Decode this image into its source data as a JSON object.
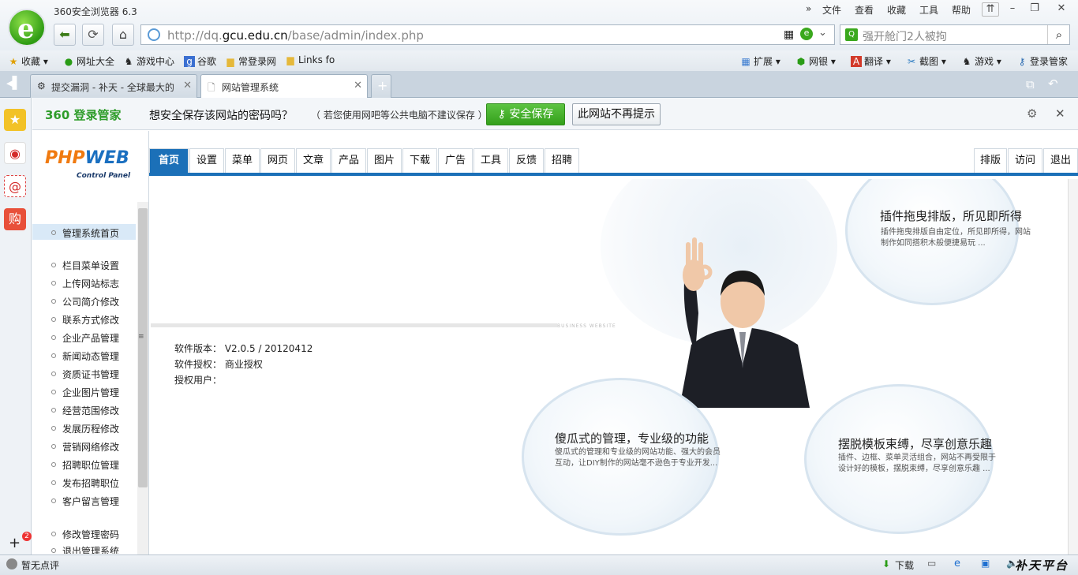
{
  "browser": {
    "title": "360安全浏览器 6.3",
    "menus": [
      "文件",
      "查看",
      "收藏",
      "工具",
      "帮助"
    ],
    "url_prefix": "http://dq.",
    "url_domain": "gcu.edu.cn",
    "url_path": "/base/admin/index.php",
    "search_placeholder": "强开舱门2人被拘"
  },
  "favorites": {
    "left": [
      "收藏",
      "网址大全",
      "游戏中心",
      "谷歌",
      "常登录网",
      "Links fo"
    ],
    "right": [
      "扩展",
      "网银",
      "翻译",
      "截图",
      "游戏",
      "登录管家"
    ]
  },
  "tabs": [
    {
      "label": "提交漏洞 - 补天 - 全球最大的"
    },
    {
      "label": "网站管理系统"
    }
  ],
  "password_bar": {
    "brand": "360 登录管家",
    "question": "想安全保存该网站的密码吗？",
    "note": "（ 若您使用网吧等公共电脑不建议保存 ）",
    "save": "安全保存",
    "never": "此网站不再提示"
  },
  "cms": {
    "logo_main": "PHP",
    "logo_accent": "WEB",
    "logo_sub": "Control Panel",
    "nav": [
      "首页",
      "设置",
      "菜单",
      "网页",
      "文章",
      "产品",
      "图片",
      "下载",
      "广告",
      "工具",
      "反馈",
      "招聘"
    ],
    "nav_right": [
      "排版",
      "访问",
      "退出"
    ],
    "menu_home": "管理系统首页",
    "menu": [
      "栏目菜单设置",
      "上传网站标志",
      "公司简介修改",
      "联系方式修改",
      "企业产品管理",
      "新闻动态管理",
      "资质证书管理",
      "企业图片管理",
      "经营范围修改",
      "发展历程修改",
      "营销网络修改",
      "招聘职位管理",
      "发布招聘职位",
      "客户留言管理"
    ],
    "menu_bottom": [
      "修改管理密码",
      "退出管理系统"
    ],
    "info": [
      {
        "k": "软件版本：",
        "v": "V2.0.5 / 20120412"
      },
      {
        "k": "软件授权：",
        "v": "商业授权"
      },
      {
        "k": "授权用户：",
        "v": ""
      }
    ],
    "business_label": "BUSINESS WEBSITE",
    "features": [
      {
        "title": "插件拖曳排版，所见即所得",
        "desc": "插件拖曳排版自由定位，所见即所得，网站制作如同搭积木般便捷易玩 ..."
      },
      {
        "title": "傻瓜式的管理，专业级的功能",
        "desc": "傻瓜式的管理和专业级的网站功能、强大的会员互动，让DIY制作的网站毫不逊色于专业开发..."
      },
      {
        "title": "摆脱模板束缚，尽享创意乐趣",
        "desc": "插件、边框、菜单灵活组合，网站不再受限于设计好的模板，摆脱束缚，尽享创意乐趣 ..."
      }
    ]
  },
  "status": {
    "left": "暂无点评",
    "download": "下载",
    "watermark": "补天平台",
    "badge": "2"
  }
}
